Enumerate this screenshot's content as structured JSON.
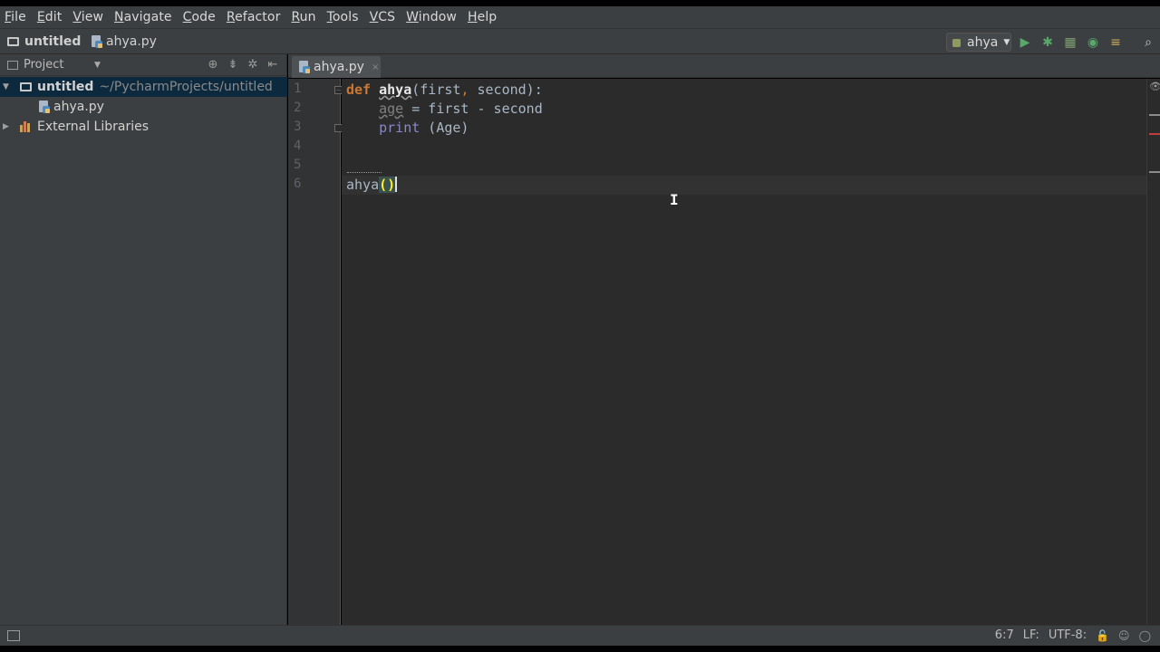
{
  "menu": [
    "File",
    "Edit",
    "View",
    "Navigate",
    "Code",
    "Refactor",
    "Run",
    "Tools",
    "VCS",
    "Window",
    "Help"
  ],
  "navbar": {
    "project": "untitled",
    "file": "ahya.py",
    "run_config": "ahya"
  },
  "project_panel": {
    "title": "Project",
    "root_label": "untitled",
    "root_path": "~/PycharmProjects/untitled",
    "file_label": "ahya.py",
    "libraries_label": "External Libraries"
  },
  "tab": {
    "label": "ahya.py",
    "close": "×"
  },
  "editor": {
    "line_numbers": [
      "1",
      "2",
      "3",
      "4",
      "5",
      "6"
    ]
  },
  "code": {
    "l1_kw": "def",
    "l1_fn": "ahya",
    "l1_open": "(first",
    "l1_comma": ",",
    "l1_rest": " second):",
    "l2_var": "age",
    "l2_rest": " = first - second",
    "l3_builtin": "print",
    "l3_rest": " (Age)",
    "l6_call": "ahya",
    "l6_parens": "()"
  },
  "status": {
    "position": "6:7",
    "line_sep": "LF:",
    "encoding": "UTF-8:"
  },
  "colors": {
    "keyword": "#cc7832",
    "builtin": "#8888c6",
    "run_green": "#59a869",
    "selection": "#0d293e"
  }
}
